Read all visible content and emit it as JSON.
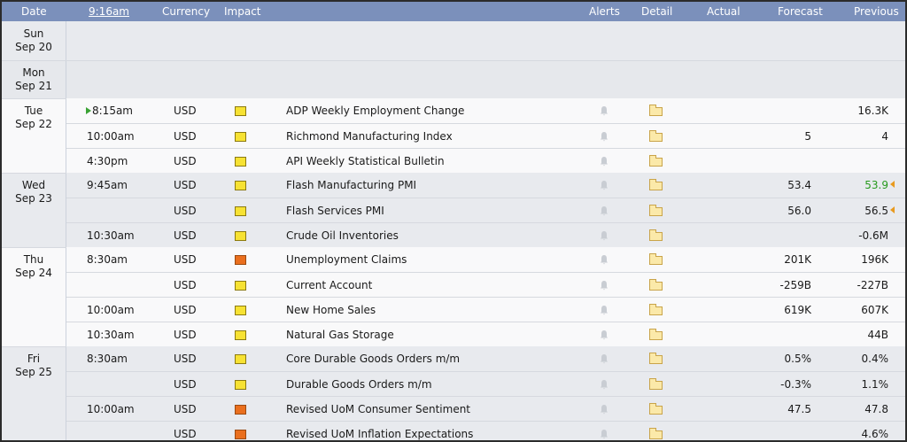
{
  "header": {
    "date": "Date",
    "time": "9:16am",
    "currency": "Currency",
    "impact": "Impact",
    "alerts": "Alerts",
    "detail": "Detail",
    "actual": "Actual",
    "forecast": "Forecast",
    "previous": "Previous"
  },
  "days": [
    {
      "dow": "Sun",
      "date": "Sep 20"
    },
    {
      "dow": "Mon",
      "date": "Sep 21"
    },
    {
      "dow": "Tue",
      "date": "Sep 22"
    },
    {
      "dow": "Wed",
      "date": "Sep 23"
    },
    {
      "dow": "Thu",
      "date": "Sep 24"
    },
    {
      "dow": "Fri",
      "date": "Sep 25"
    }
  ],
  "events": [
    {
      "time": "8:15am",
      "currency": "USD",
      "impact": "yellow",
      "event": "ADP Weekly Employment Change",
      "actual": "",
      "forecast": "",
      "previous": "16.3K"
    },
    {
      "time": "10:00am",
      "currency": "USD",
      "impact": "yellow",
      "event": "Richmond Manufacturing Index",
      "actual": "",
      "forecast": "5",
      "previous": "4"
    },
    {
      "time": "4:30pm",
      "currency": "USD",
      "impact": "yellow",
      "event": "API Weekly Statistical Bulletin",
      "actual": "",
      "forecast": "",
      "previous": ""
    },
    {
      "time": "9:45am",
      "currency": "USD",
      "impact": "yellow",
      "event": "Flash Manufacturing PMI",
      "actual": "",
      "forecast": "53.4",
      "previous": "53.9"
    },
    {
      "time": "",
      "currency": "USD",
      "impact": "yellow",
      "event": "Flash Services PMI",
      "actual": "",
      "forecast": "56.0",
      "previous": "56.5"
    },
    {
      "time": "10:30am",
      "currency": "USD",
      "impact": "yellow",
      "event": "Crude Oil Inventories",
      "actual": "",
      "forecast": "",
      "previous": "-0.6M"
    },
    {
      "time": "8:30am",
      "currency": "USD",
      "impact": "orange",
      "event": "Unemployment Claims",
      "actual": "",
      "forecast": "201K",
      "previous": "196K"
    },
    {
      "time": "",
      "currency": "USD",
      "impact": "yellow",
      "event": "Current Account",
      "actual": "",
      "forecast": "-259B",
      "previous": "-227B"
    },
    {
      "time": "10:00am",
      "currency": "USD",
      "impact": "yellow",
      "event": "New Home Sales",
      "actual": "",
      "forecast": "619K",
      "previous": "607K"
    },
    {
      "time": "10:30am",
      "currency": "USD",
      "impact": "yellow",
      "event": "Natural Gas Storage",
      "actual": "",
      "forecast": "",
      "previous": "44B"
    },
    {
      "time": "8:30am",
      "currency": "USD",
      "impact": "yellow",
      "event": "Core Durable Goods Orders m/m",
      "actual": "",
      "forecast": "0.5%",
      "previous": "0.4%"
    },
    {
      "time": "",
      "currency": "USD",
      "impact": "yellow",
      "event": "Durable Goods Orders m/m",
      "actual": "",
      "forecast": "-0.3%",
      "previous": "1.1%"
    },
    {
      "time": "10:00am",
      "currency": "USD",
      "impact": "orange",
      "event": "Revised UoM Consumer Sentiment",
      "actual": "",
      "forecast": "47.5",
      "previous": "47.8"
    },
    {
      "time": "",
      "currency": "USD",
      "impact": "orange",
      "event": "Revised UoM Inflation Expectations",
      "actual": "",
      "forecast": "",
      "previous": "4.6%"
    }
  ],
  "colors": {
    "header_bg": "#7b90bb",
    "impact_yellow": "#f7e233",
    "impact_orange": "#ea6f1e",
    "previous_better": "#269a1d"
  }
}
